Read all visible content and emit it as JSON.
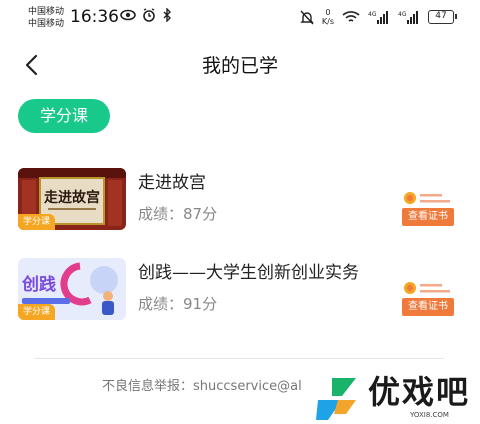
{
  "status_bar": {
    "carrier_1": "中国移动",
    "carrier_2": "中国移动",
    "time": "16:36",
    "speed_value": "0",
    "speed_unit": "K/s",
    "battery": "47"
  },
  "header": {
    "title": "我的已学"
  },
  "tag": {
    "label": "学分课"
  },
  "courses": [
    {
      "name": "走进故宫",
      "score": "成绩：87分",
      "badge": "学分课",
      "thumb_title": "走进故宫",
      "cert_label": "查看证书"
    },
    {
      "name": "创践——大学生创新创业实务",
      "score": "成绩：91分",
      "badge": "学分课",
      "thumb_title": "创践",
      "cert_label": "查看证书"
    }
  ],
  "footer": {
    "text": "不良信息举报：shuccservice@al"
  },
  "watermark": {
    "brand": "优戏吧",
    "url": "YOXI8.COM"
  },
  "colors": {
    "accent": "#19c98b",
    "cert": "#f07a3c",
    "badge": "#f5a623"
  }
}
